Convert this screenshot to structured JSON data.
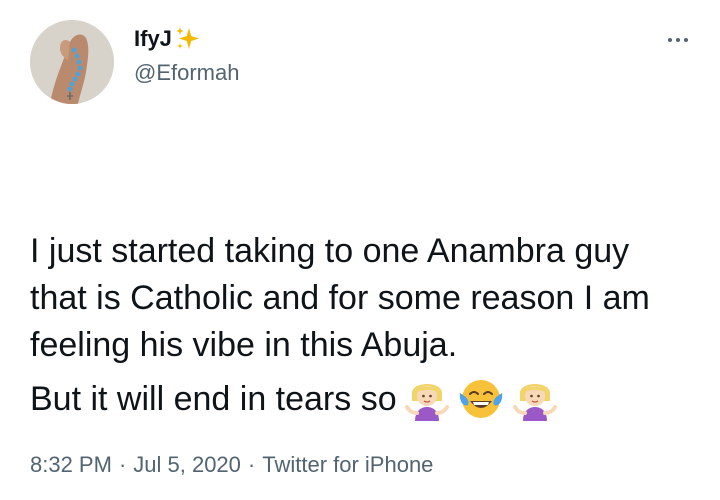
{
  "author": {
    "display_name": "IfyJ",
    "name_badge_icon": "sparkles-icon",
    "handle": "@Eformah",
    "avatar_icon": "avatar-hand-rosary"
  },
  "more_menu": {
    "icon": "more-dots-icon"
  },
  "tweet": {
    "paragraph_1": "I just started taking to one Anambra guy that is Catholic and for some reason I am feeling his vibe in this Abuja.",
    "paragraph_2": "But it will end in tears so",
    "emojis": [
      "person-shrugging-emoji",
      "face-with-tears-of-joy-emoji",
      "person-shrugging-emoji"
    ]
  },
  "meta": {
    "time": "8:32 PM",
    "separator": "·",
    "date": "Jul 5, 2020",
    "source": "Twitter for iPhone"
  },
  "colors": {
    "text_primary": "#0f1419",
    "text_secondary": "#536471",
    "sparkle": "#f5b800"
  }
}
